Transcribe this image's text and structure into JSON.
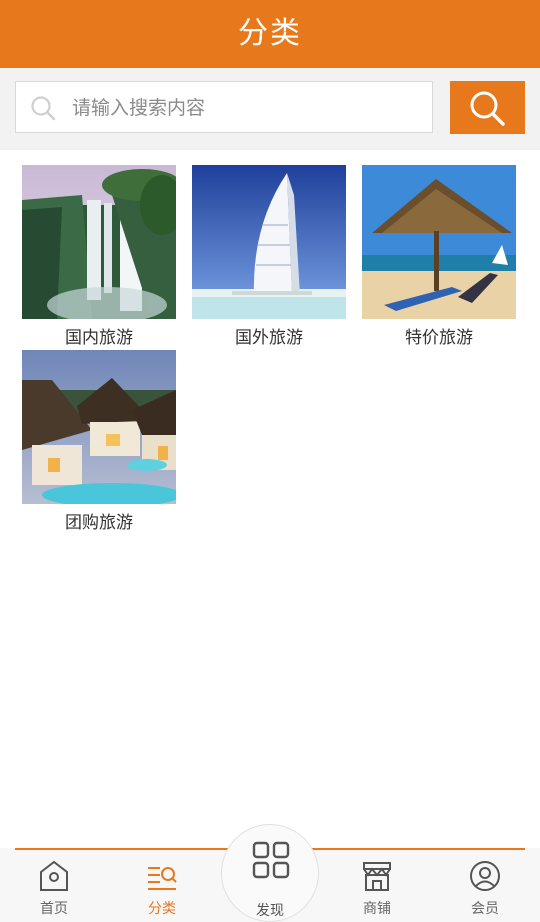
{
  "header": {
    "title": "分类"
  },
  "search": {
    "placeholder": "请输入搜索内容",
    "value": ""
  },
  "categories": [
    {
      "label": "国内旅游",
      "image": "waterfall"
    },
    {
      "label": "国外旅游",
      "image": "sail-hotel"
    },
    {
      "label": "特价旅游",
      "image": "beach-umbrella"
    },
    {
      "label": "团购旅游",
      "image": "resort-villas"
    }
  ],
  "tabbar": {
    "home": "首页",
    "category": "分类",
    "discover": "发现",
    "shop": "商铺",
    "member": "会员"
  },
  "colors": {
    "accent": "#e8781c",
    "text": "#333333",
    "muted": "#666666"
  }
}
